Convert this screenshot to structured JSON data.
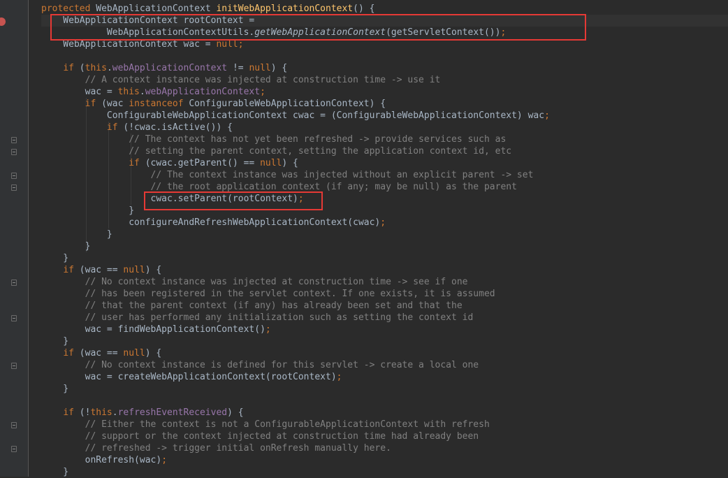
{
  "editor": {
    "lines": [
      [
        {
          "t": "protected ",
          "s": "kw"
        },
        {
          "t": "WebApplicationContext ",
          "s": "plain"
        },
        {
          "t": "initWebApplicationContext",
          "s": "fn"
        },
        {
          "t": "() {",
          "s": "plain"
        }
      ],
      [
        {
          "t": "    WebApplicationContext rootContext =",
          "s": "plain"
        }
      ],
      [
        {
          "t": "            WebApplicationContextUtils.",
          "s": "plain"
        },
        {
          "t": "getWebApplicationContext",
          "s": "static"
        },
        {
          "t": "(getServletContext())",
          "s": "plain"
        },
        {
          "t": ";",
          "s": "kw"
        }
      ],
      [
        {
          "t": "    WebApplicationContext wac = ",
          "s": "plain"
        },
        {
          "t": "null",
          "s": "kw"
        },
        {
          "t": ";",
          "s": "kw"
        }
      ],
      [],
      [
        {
          "t": "    ",
          "s": "plain"
        },
        {
          "t": "if ",
          "s": "kw"
        },
        {
          "t": "(",
          "s": "plain"
        },
        {
          "t": "this",
          "s": "kw"
        },
        {
          "t": ".",
          "s": "plain"
        },
        {
          "t": "webApplicationContext",
          "s": "fld"
        },
        {
          "t": " != ",
          "s": "plain"
        },
        {
          "t": "null",
          "s": "kw"
        },
        {
          "t": ") {",
          "s": "plain"
        }
      ],
      [
        {
          "t": "        // A context instance was injected at construction time -> use it",
          "s": "cmt"
        }
      ],
      [
        {
          "t": "        wac = ",
          "s": "plain"
        },
        {
          "t": "this",
          "s": "kw"
        },
        {
          "t": ".",
          "s": "plain"
        },
        {
          "t": "webApplicationContext",
          "s": "fld"
        },
        {
          "t": ";",
          "s": "kw"
        }
      ],
      [
        {
          "t": "        ",
          "s": "plain"
        },
        {
          "t": "if ",
          "s": "kw"
        },
        {
          "t": "(wac ",
          "s": "plain"
        },
        {
          "t": "instanceof ",
          "s": "kw"
        },
        {
          "t": "ConfigurableWebApplicationContext) {",
          "s": "plain"
        }
      ],
      [
        {
          "t": "            ConfigurableWebApplicationContext cwac = (ConfigurableWebApplicationContext) wac",
          "s": "plain"
        },
        {
          "t": ";",
          "s": "kw"
        }
      ],
      [
        {
          "t": "            ",
          "s": "plain"
        },
        {
          "t": "if ",
          "s": "kw"
        },
        {
          "t": "(!cwac.isActive()) {",
          "s": "plain"
        }
      ],
      [
        {
          "t": "                // The context has not yet been refreshed -> provide services such as",
          "s": "cmt"
        }
      ],
      [
        {
          "t": "                // setting the parent context, setting the application context id, etc",
          "s": "cmt"
        }
      ],
      [
        {
          "t": "                ",
          "s": "plain"
        },
        {
          "t": "if ",
          "s": "kw"
        },
        {
          "t": "(cwac.getParent() == ",
          "s": "plain"
        },
        {
          "t": "null",
          "s": "kw"
        },
        {
          "t": ") {",
          "s": "plain"
        }
      ],
      [
        {
          "t": "                    // The context instance was injected without an explicit parent -> set",
          "s": "cmt"
        }
      ],
      [
        {
          "t": "                    // the root application context (if any; may be null) as the parent",
          "s": "cmt"
        }
      ],
      [
        {
          "t": "                    cwac.setParent(rootContext)",
          "s": "plain"
        },
        {
          "t": ";",
          "s": "kw"
        }
      ],
      [
        {
          "t": "                }",
          "s": "plain"
        }
      ],
      [
        {
          "t": "                configureAndRefreshWebApplicationContext(cwac)",
          "s": "plain"
        },
        {
          "t": ";",
          "s": "kw"
        }
      ],
      [
        {
          "t": "            }",
          "s": "plain"
        }
      ],
      [
        {
          "t": "        }",
          "s": "plain"
        }
      ],
      [
        {
          "t": "    }",
          "s": "plain"
        }
      ],
      [
        {
          "t": "    ",
          "s": "plain"
        },
        {
          "t": "if ",
          "s": "kw"
        },
        {
          "t": "(wac == ",
          "s": "plain"
        },
        {
          "t": "null",
          "s": "kw"
        },
        {
          "t": ") {",
          "s": "plain"
        }
      ],
      [
        {
          "t": "        // No context instance was injected at construction time -> see if one",
          "s": "cmt"
        }
      ],
      [
        {
          "t": "        // has been registered in the servlet context. If one exists, it is assumed",
          "s": "cmt"
        }
      ],
      [
        {
          "t": "        // that the parent context (if any) has already been set and that the",
          "s": "cmt"
        }
      ],
      [
        {
          "t": "        // user has performed any initialization such as setting the context id",
          "s": "cmt"
        }
      ],
      [
        {
          "t": "        wac = findWebApplicationContext()",
          "s": "plain"
        },
        {
          "t": ";",
          "s": "kw"
        }
      ],
      [
        {
          "t": "    }",
          "s": "plain"
        }
      ],
      [
        {
          "t": "    ",
          "s": "plain"
        },
        {
          "t": "if ",
          "s": "kw"
        },
        {
          "t": "(wac == ",
          "s": "plain"
        },
        {
          "t": "null",
          "s": "kw"
        },
        {
          "t": ") {",
          "s": "plain"
        }
      ],
      [
        {
          "t": "        // No context instance is defined for this servlet -> create a local one",
          "s": "cmt"
        }
      ],
      [
        {
          "t": "        wac = createWebApplicationContext(rootContext)",
          "s": "plain"
        },
        {
          "t": ";",
          "s": "kw"
        }
      ],
      [
        {
          "t": "    }",
          "s": "plain"
        }
      ],
      [],
      [
        {
          "t": "    ",
          "s": "plain"
        },
        {
          "t": "if ",
          "s": "kw"
        },
        {
          "t": "(!",
          "s": "plain"
        },
        {
          "t": "this",
          "s": "kw"
        },
        {
          "t": ".",
          "s": "plain"
        },
        {
          "t": "refreshEventReceived",
          "s": "fld"
        },
        {
          "t": ") {",
          "s": "plain"
        }
      ],
      [
        {
          "t": "        // Either the context is not a ConfigurableApplicationContext with refresh",
          "s": "cmt"
        }
      ],
      [
        {
          "t": "        // support or the context injected at construction time had already been",
          "s": "cmt"
        }
      ],
      [
        {
          "t": "        // refreshed -> trigger initial onRefresh manually here.",
          "s": "cmt"
        }
      ],
      [
        {
          "t": "        onRefresh(wac)",
          "s": "plain"
        },
        {
          "t": ";",
          "s": "kw"
        }
      ],
      [
        {
          "t": "    }",
          "s": "plain"
        }
      ]
    ]
  },
  "colors": {
    "background": "#2b2b2b",
    "keyword": "#cc7832",
    "field": "#9876aa",
    "method_declaration": "#ffc66d",
    "comment": "#808080",
    "text": "#a9b7c6",
    "annotation_box": "#e53935",
    "breakpoint": "#c75450"
  }
}
